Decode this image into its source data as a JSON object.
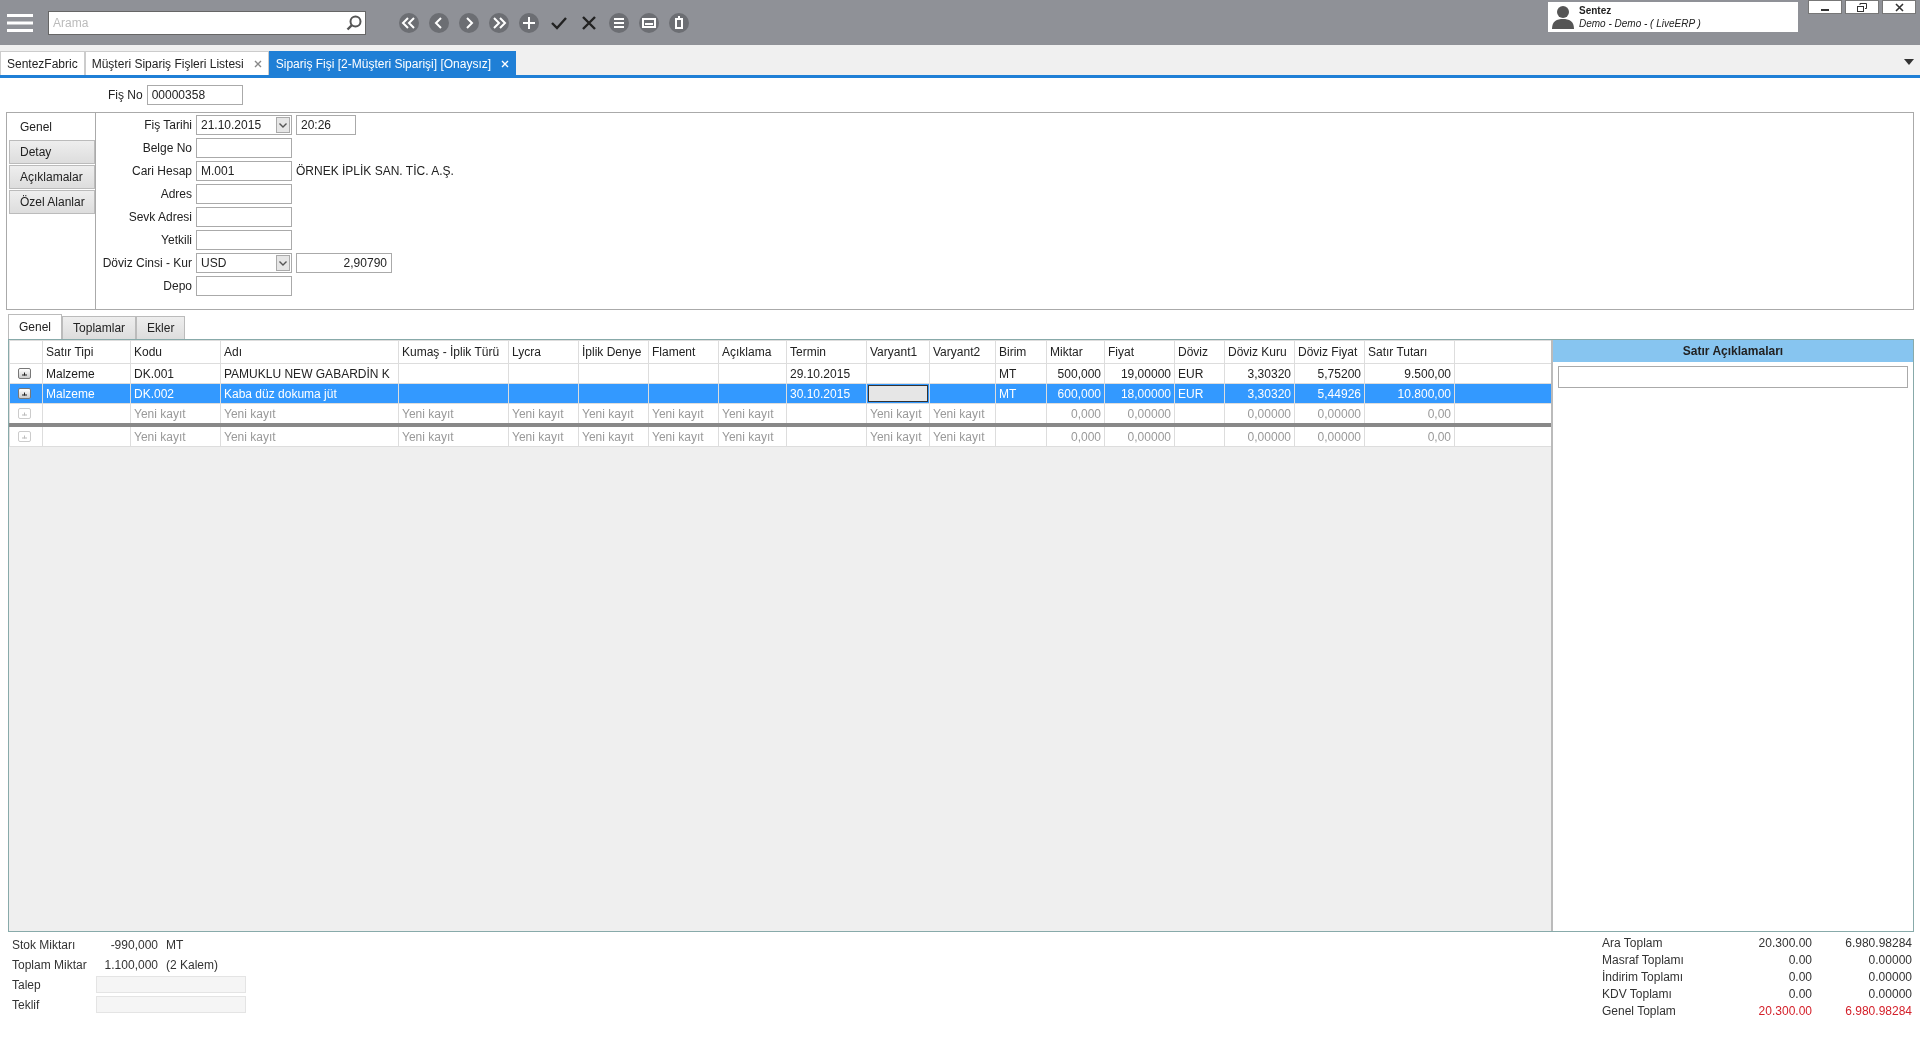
{
  "search": {
    "placeholder": "Arama"
  },
  "user": {
    "name": "Sentez",
    "detail": "Demo - Demo - ( LiveERP )"
  },
  "doc_tabs": [
    {
      "label": "SentezFabric",
      "selected": false,
      "closable": false
    },
    {
      "label": "Müşteri Sipariş Fişleri Listesi",
      "selected": false,
      "closable": true
    },
    {
      "label": "Sipariş Fişi [2-Müşteri Siparişi] [Onaysız]",
      "selected": true,
      "closable": true
    }
  ],
  "header": {
    "fis_no": {
      "label": "Fiş No",
      "value": "00000358"
    },
    "side_tabs": [
      {
        "label": "Genel",
        "selected": true
      },
      {
        "label": "Detay",
        "selected": false
      },
      {
        "label": "Açıklamalar",
        "selected": false
      },
      {
        "label": "Özel Alanlar",
        "selected": false
      }
    ],
    "fields": [
      {
        "label": "Fiş Tarihi",
        "kind": "date",
        "value": "21.10.2015",
        "extra": "20:26"
      },
      {
        "label": "Belge No",
        "kind": "text"
      },
      {
        "label": "Cari Hesap",
        "kind": "text",
        "value": "M.001",
        "note": "ÖRNEK İPLİK SAN. TİC. A.Ş."
      },
      {
        "label": "Adres",
        "kind": "text"
      },
      {
        "label": "Sevk Adresi",
        "kind": "text"
      },
      {
        "label": "Yetkili",
        "kind": "text"
      },
      {
        "label": "Döviz Cinsi - Kur",
        "kind": "combo",
        "value": "USD",
        "extra": "2,90790"
      },
      {
        "label": "Depo",
        "kind": "text"
      }
    ]
  },
  "line_tabs": [
    {
      "label": "Genel",
      "selected": true
    },
    {
      "label": "Toplamlar",
      "selected": false
    },
    {
      "label": "Ekler",
      "selected": false
    }
  ],
  "grid": {
    "columns": [
      "Satır Tipi",
      "Kodu",
      "Adı",
      "Kumaş - İplik Türü",
      "Lycra",
      "İplik Denye",
      "Flament",
      "Açıklama",
      "Termin",
      "Varyant1",
      "Varyant2",
      "Birim",
      "Miktar",
      "Fiyat",
      "Döviz",
      "Döviz Kuru",
      "Döviz Fiyat",
      "Satır Tutarı"
    ],
    "rows": [
      {
        "kind": "data",
        "selected": false,
        "cells": [
          "Malzeme",
          "DK.001",
          "PAMUKLU NEW GABARDİN K",
          null,
          null,
          null,
          null,
          null,
          "29.10.2015",
          null,
          null,
          "MT",
          "500,000",
          "19,00000",
          "EUR",
          "3,30320",
          "5,75200",
          "9.500,00"
        ]
      },
      {
        "kind": "data",
        "selected": true,
        "cells": [
          "Malzeme",
          "DK.002",
          "Kaba düz dokuma jüt",
          null,
          null,
          null,
          null,
          null,
          "30.10.2015",
          {
            "focused": true
          },
          null,
          "MT",
          "600,000",
          "18,00000",
          "EUR",
          "3,30320",
          "5,44926",
          "10.800,00"
        ]
      },
      {
        "kind": "new",
        "selected": false,
        "cells": [
          null,
          "Yeni kayıt",
          "Yeni kayıt",
          "Yeni kayıt",
          "Yeni kayıt",
          "Yeni kayıt",
          "Yeni kayıt",
          "Yeni kayıt",
          null,
          "Yeni kayıt",
          "Yeni kayıt",
          null,
          "0,000",
          "0,00000",
          null,
          "0,00000",
          "0,00000",
          "0,00"
        ]
      },
      {
        "kind": "new",
        "selected": false,
        "separated": true,
        "cells": [
          null,
          "Yeni kayıt",
          "Yeni kayıt",
          "Yeni kayıt",
          "Yeni kayıt",
          "Yeni kayıt",
          "Yeni kayıt",
          "Yeni kayıt",
          null,
          "Yeni kayıt",
          "Yeni kayıt",
          null,
          "0,000",
          "0,00000",
          null,
          "0,00000",
          "0,00000",
          "0,00"
        ]
      }
    ]
  },
  "line_notes": {
    "title": "Satır Açıklamaları"
  },
  "stats": [
    {
      "label": "Stok Miktarı",
      "kind": "value",
      "value": "-990,000",
      "unit": "MT"
    },
    {
      "label": "Toplam Miktar",
      "kind": "value",
      "value": "1.100,000",
      "unit": "(2 Kalem)"
    },
    {
      "label": "Talep",
      "kind": "field"
    },
    {
      "label": "Teklif",
      "kind": "field"
    }
  ],
  "totals": [
    {
      "label": "Ara Toplam",
      "local": "20.300.00",
      "foreign": "6.980.98284",
      "highlight": false
    },
    {
      "label": "Masraf Toplamı",
      "local": "0.00",
      "foreign": "0.00000",
      "highlight": false
    },
    {
      "label": "İndirim Toplamı",
      "local": "0.00",
      "foreign": "0.00000",
      "highlight": false
    },
    {
      "label": "KDV Toplamı",
      "local": "0.00",
      "foreign": "0.00000",
      "highlight": false
    },
    {
      "label": "Genel Toplam",
      "local": "20.300.00",
      "foreign": "6.980.98284",
      "highlight": true
    }
  ]
}
